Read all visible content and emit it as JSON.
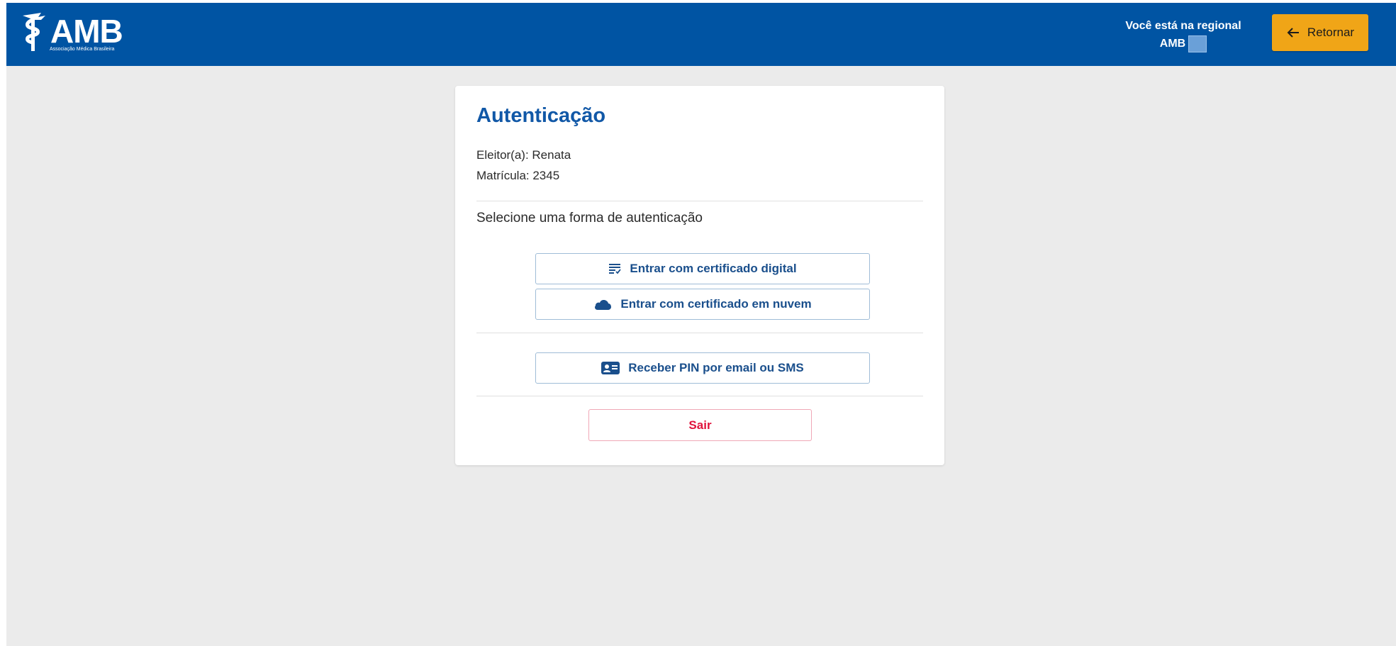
{
  "header": {
    "logo_text": "AMB",
    "logo_subtitle": "Associação Médica Brasileira",
    "regional_label": "Você está na regional",
    "regional_name": "AMB",
    "back_button_label": "Retornar",
    "back_icon": "arrow-left-icon"
  },
  "card": {
    "title": "Autenticação",
    "voter_line": "Eleitor(a): Renata",
    "registration_line": "Matrícula: 2345",
    "select_prompt": "Selecione uma forma de autenticação",
    "options": [
      {
        "label": "Entrar com certificado digital",
        "icon": "certificate-list-icon"
      },
      {
        "label": "Entrar com certificado em nuvem",
        "icon": "cloud-icon"
      },
      {
        "label": "Receber PIN por email ou SMS",
        "icon": "id-card-icon"
      }
    ],
    "exit_label": "Sair"
  },
  "colors": {
    "header_bg": "#0054a3",
    "accent_yellow": "#f0a517",
    "title_blue": "#1158a7",
    "exit_red": "#e0123b",
    "page_bg": "#ebebeb"
  }
}
